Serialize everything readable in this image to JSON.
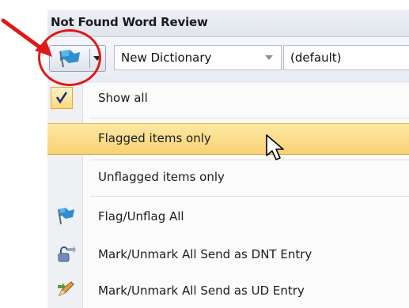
{
  "panel": {
    "title": "Not Found Word Review"
  },
  "toolbar": {
    "flag_button_icon": "flag-icon",
    "dictionary_value": "New Dictionary",
    "type_value": "(default)"
  },
  "menu": {
    "items": [
      {
        "label": "Show all",
        "icon": "checkmark-icon",
        "checked": true
      },
      {
        "label": "Flagged items only",
        "highlighted": true
      },
      {
        "label": "Unflagged items only"
      },
      {
        "label": "Flag/Unflag All",
        "icon": "flag-icon"
      },
      {
        "label": "Mark/Unmark All Send as DNT Entry",
        "icon": "lock-arrow-icon"
      },
      {
        "label": "Mark/Unmark All Send as UD Entry",
        "icon": "pencil-arrow-icon"
      }
    ]
  },
  "colors": {
    "highlight": "#f8d273",
    "annotation": "#e01818",
    "flag": "#2c8fd0"
  }
}
